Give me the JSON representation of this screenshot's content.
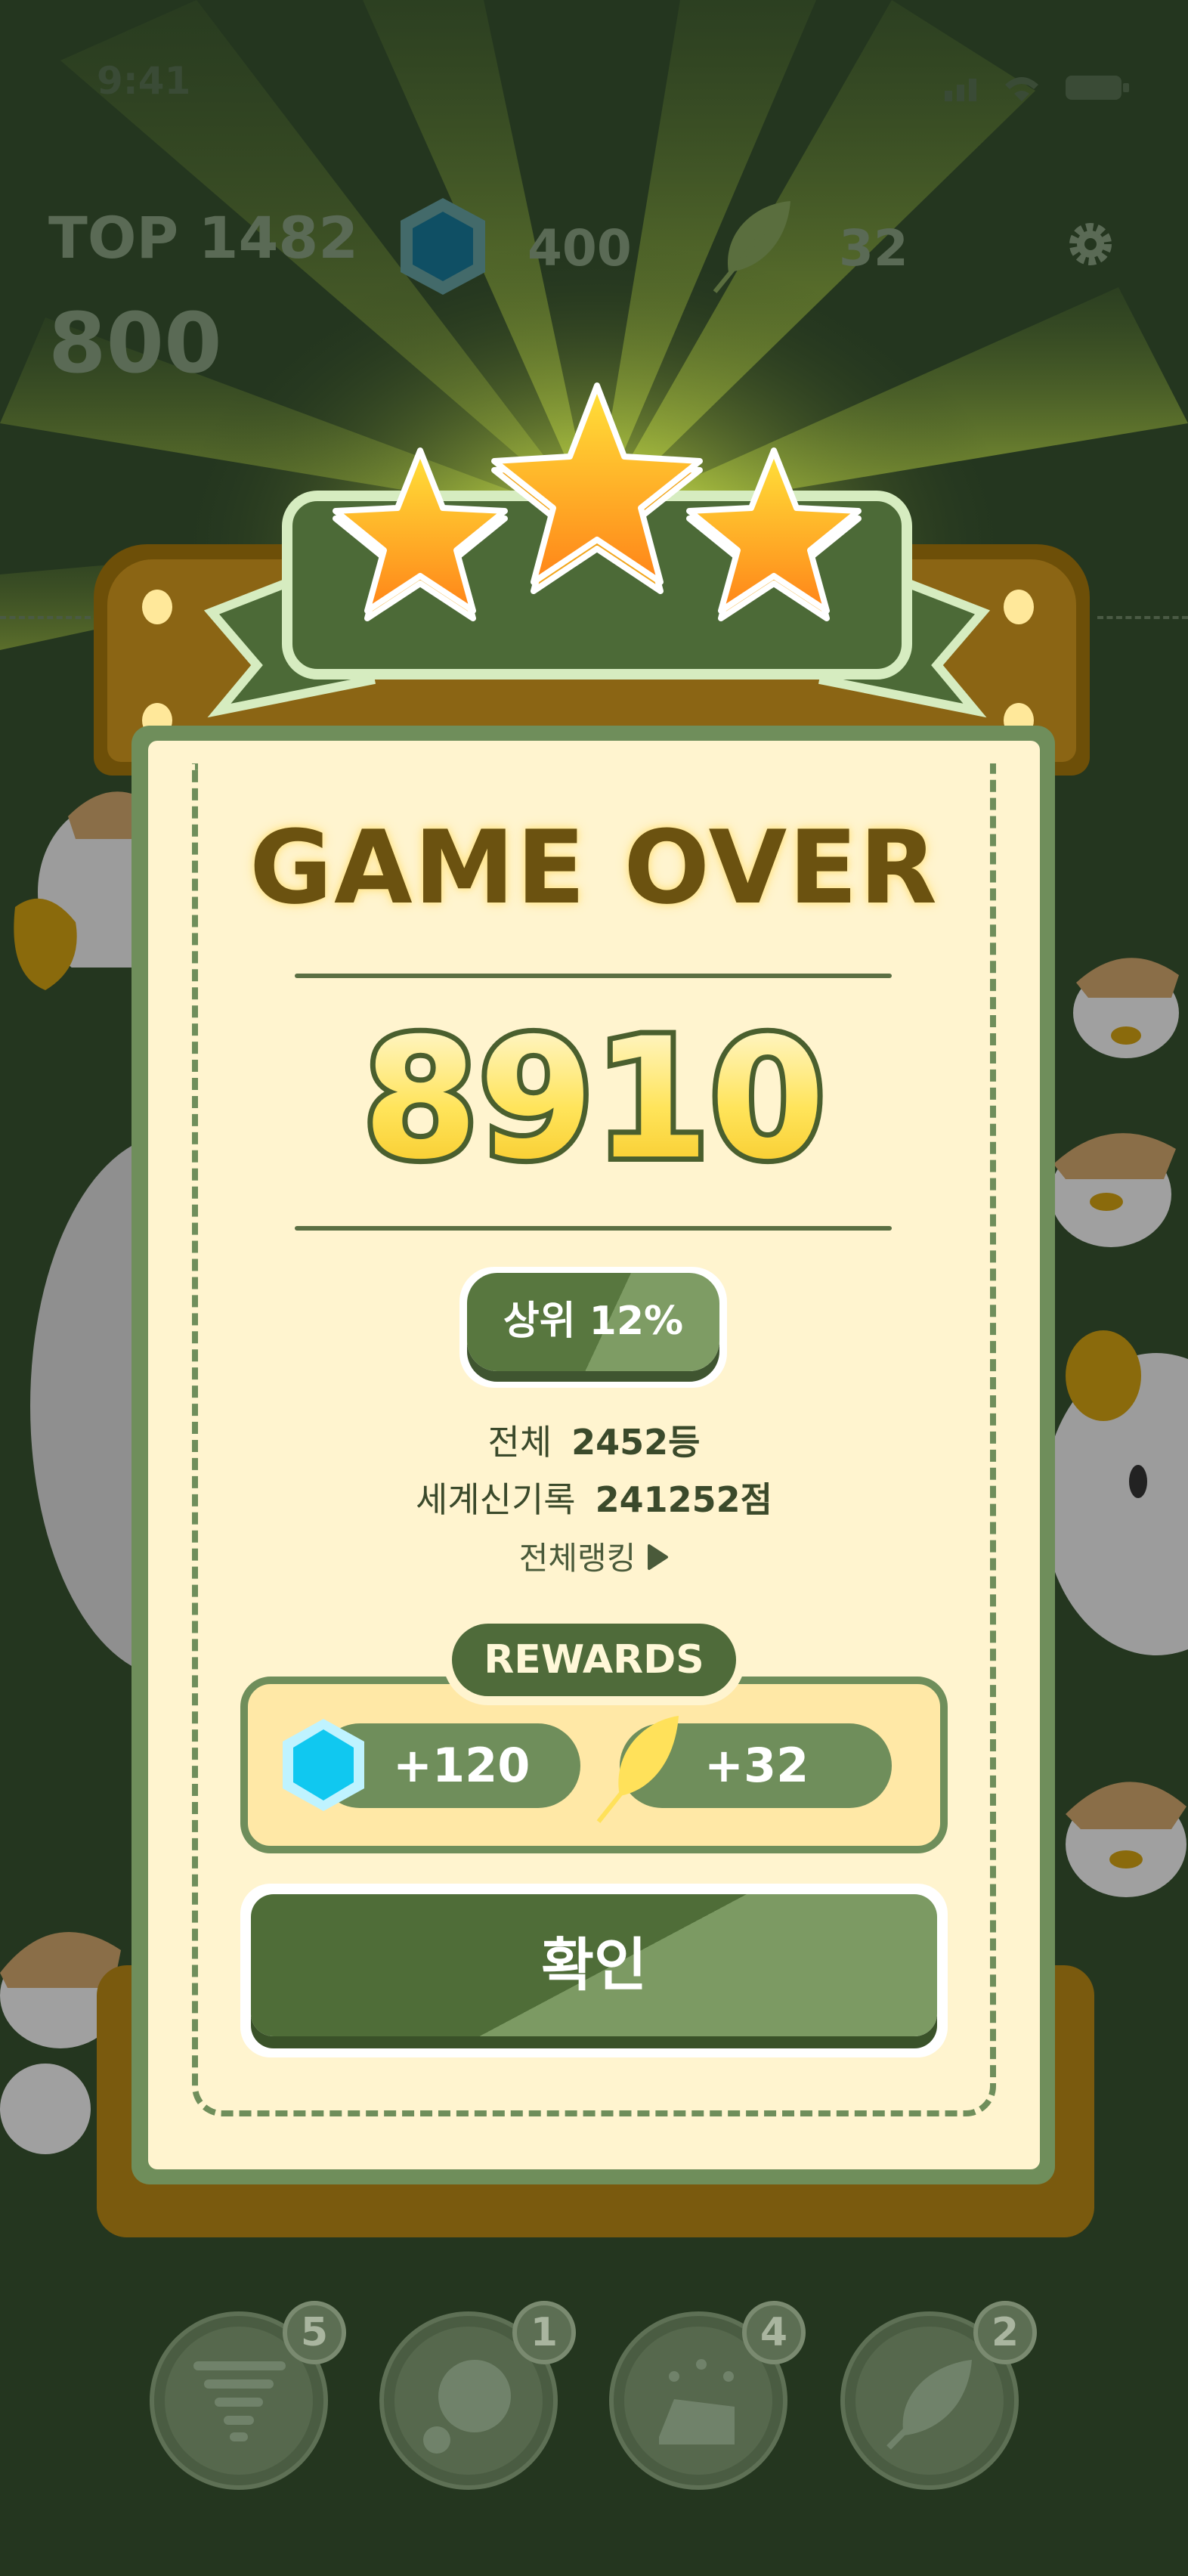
{
  "status_bar": {
    "time": "9:41"
  },
  "hud": {
    "top_label": "TOP 1482",
    "current_score": "800",
    "gems": "400",
    "leaves": "32"
  },
  "result": {
    "title": "GAME OVER",
    "score": "8910",
    "stars": 3,
    "rank_badge": "상위 12%",
    "total_label": "전체",
    "total_value": "2452등",
    "world_record_label": "세계신기록",
    "world_record_value": "241252점",
    "ranking_link": "전체랭킹"
  },
  "rewards": {
    "label": "REWARDS",
    "gems": "+120",
    "leaves": "+32"
  },
  "confirm_label": "확인",
  "powerups": [
    {
      "icon": "tornado-icon",
      "count": "5"
    },
    {
      "icon": "bubble-icon",
      "count": "1"
    },
    {
      "icon": "cake-icon",
      "count": "4"
    },
    {
      "icon": "leaf-icon",
      "count": "2"
    }
  ],
  "colors": {
    "background": "#24361f",
    "card": "#fff4cf",
    "green": "#6f8e5b",
    "brown": "#8b6514",
    "gold": "#ffe23a"
  }
}
